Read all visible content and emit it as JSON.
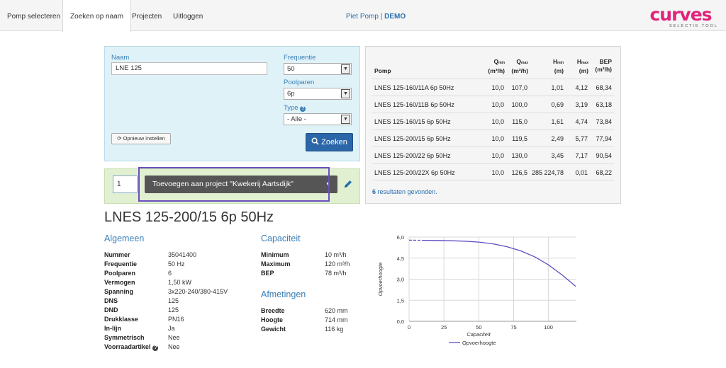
{
  "nav": {
    "tabs": [
      {
        "label": "Pomp selecteren"
      },
      {
        "label": "Zoeken op naam"
      },
      {
        "label": "Projecten"
      },
      {
        "label": "Uitloggen"
      }
    ],
    "user": "Piet Pomp",
    "separator": "|",
    "mode": "DEMO",
    "logo": {
      "main": "curves",
      "sub": "SELECTIE TOOL",
      "color": "#e0257a"
    }
  },
  "search": {
    "naam_label": "Naam",
    "naam_value": "LNE 125",
    "frequentie_label": "Frequentie",
    "frequentie_value": "50",
    "poolparen_label": "Poolparen",
    "poolparen_value": "6p",
    "type_label": "Type",
    "type_value": "- Alle -",
    "reset_label": "Opnieuw instellen",
    "search_label": "Zoeken"
  },
  "project": {
    "quantity": "1",
    "add_label": "Toevoegen aan project \"Kwekerij Aartsdijk\""
  },
  "results": {
    "headers": {
      "pomp": "Pomp",
      "qmin": "Q",
      "qmin_sub": "min",
      "qmin_unit": "(m³/h)",
      "qmax": "Q",
      "qmax_sub": "max",
      "qmax_unit": "(m³/h)",
      "hmin": "H",
      "hmin_sub": "min",
      "hmin_unit": "(m)",
      "hmax": "H",
      "hmax_sub": "max",
      "hmax_unit": "(m)",
      "bep": "BEP",
      "bep_unit": "(m³/h)"
    },
    "rows": [
      {
        "pomp": "LNES 125-160/11A 6p 50Hz",
        "qmin": "10,0",
        "qmax": "107,0",
        "hmin": "1,01",
        "hmax": "4,12",
        "bep": "68,34"
      },
      {
        "pomp": "LNES 125-160/11B 6p 50Hz",
        "qmin": "10,0",
        "qmax": "100,0",
        "hmin": "0,69",
        "hmax": "3,19",
        "bep": "63,18"
      },
      {
        "pomp": "LNES 125-160/15 6p 50Hz",
        "qmin": "10,0",
        "qmax": "115,0",
        "hmin": "1,61",
        "hmax": "4,74",
        "bep": "73,84"
      },
      {
        "pomp": "LNES 125-200/15 6p 50Hz",
        "qmin": "10,0",
        "qmax": "119,5",
        "hmin": "2,49",
        "hmax": "5,77",
        "bep": "77,94"
      },
      {
        "pomp": "LNES 125-200/22 6p 50Hz",
        "qmin": "10,0",
        "qmax": "130,0",
        "hmin": "3,45",
        "hmax": "7,17",
        "bep": "90,54"
      },
      {
        "pomp": "LNES 125-200/22X 6p 50Hz",
        "qmin": "10,0",
        "qmax": "126,5",
        "hmin": "285 224,78",
        "hmax": "0,01",
        "bep": "68,22"
      }
    ],
    "count": "6",
    "count_suffix": "resultaten gevonden."
  },
  "detail": {
    "title": "LNES 125-200/15 6p 50Hz",
    "algemeen": {
      "heading": "Algemeen",
      "items": [
        {
          "k": "Nummer",
          "v": "35041400"
        },
        {
          "k": "Frequentie",
          "v": "50 Hz"
        },
        {
          "k": "Poolparen",
          "v": "6"
        },
        {
          "k": "Vermogen",
          "v": "1,50 kW"
        },
        {
          "k": "Spanning",
          "v": "3x220-240/380-415V"
        },
        {
          "k": "DNS",
          "v": "125"
        },
        {
          "k": "DND",
          "v": "125"
        },
        {
          "k": "Drukklasse",
          "v": "PN16"
        },
        {
          "k": "In-lijn",
          "v": "Ja"
        },
        {
          "k": "Symmetrisch",
          "v": "Nee"
        },
        {
          "k": "Voorraadartikel",
          "v": "Nee"
        }
      ]
    },
    "capaciteit": {
      "heading": "Capaciteit",
      "items": [
        {
          "k": "Minimum",
          "v": "10 m³/h"
        },
        {
          "k": "Maximum",
          "v": "120 m³/h"
        },
        {
          "k": "BEP",
          "v": "78 m³/h"
        }
      ]
    },
    "afmetingen": {
      "heading": "Afmetingen",
      "items": [
        {
          "k": "Breedte",
          "v": "620 mm"
        },
        {
          "k": "Hoogte",
          "v": "714 mm"
        },
        {
          "k": "Gewicht",
          "v": "116 kg"
        }
      ]
    }
  },
  "chart_data": {
    "type": "line",
    "xlabel": "Capaciteit",
    "ylabel": "Opvoerhoogte",
    "xlim": [
      0,
      120
    ],
    "ylim": [
      0,
      6
    ],
    "x_ticks": [
      "0",
      "25",
      "50",
      "75",
      "100"
    ],
    "y_ticks": [
      "0,0",
      "1,5",
      "3,0",
      "4,5",
      "6,0"
    ],
    "grid": true,
    "legend_position": "bottom",
    "series": [
      {
        "name": "Opvoerhoogte",
        "color": "#5b4fc0",
        "dashed_until_x": 10,
        "x": [
          0,
          10,
          20,
          30,
          40,
          50,
          60,
          70,
          80,
          90,
          100,
          110,
          119.5
        ],
        "y": [
          5.78,
          5.77,
          5.76,
          5.74,
          5.71,
          5.64,
          5.52,
          5.32,
          5.02,
          4.6,
          4.02,
          3.28,
          2.49
        ]
      }
    ]
  }
}
